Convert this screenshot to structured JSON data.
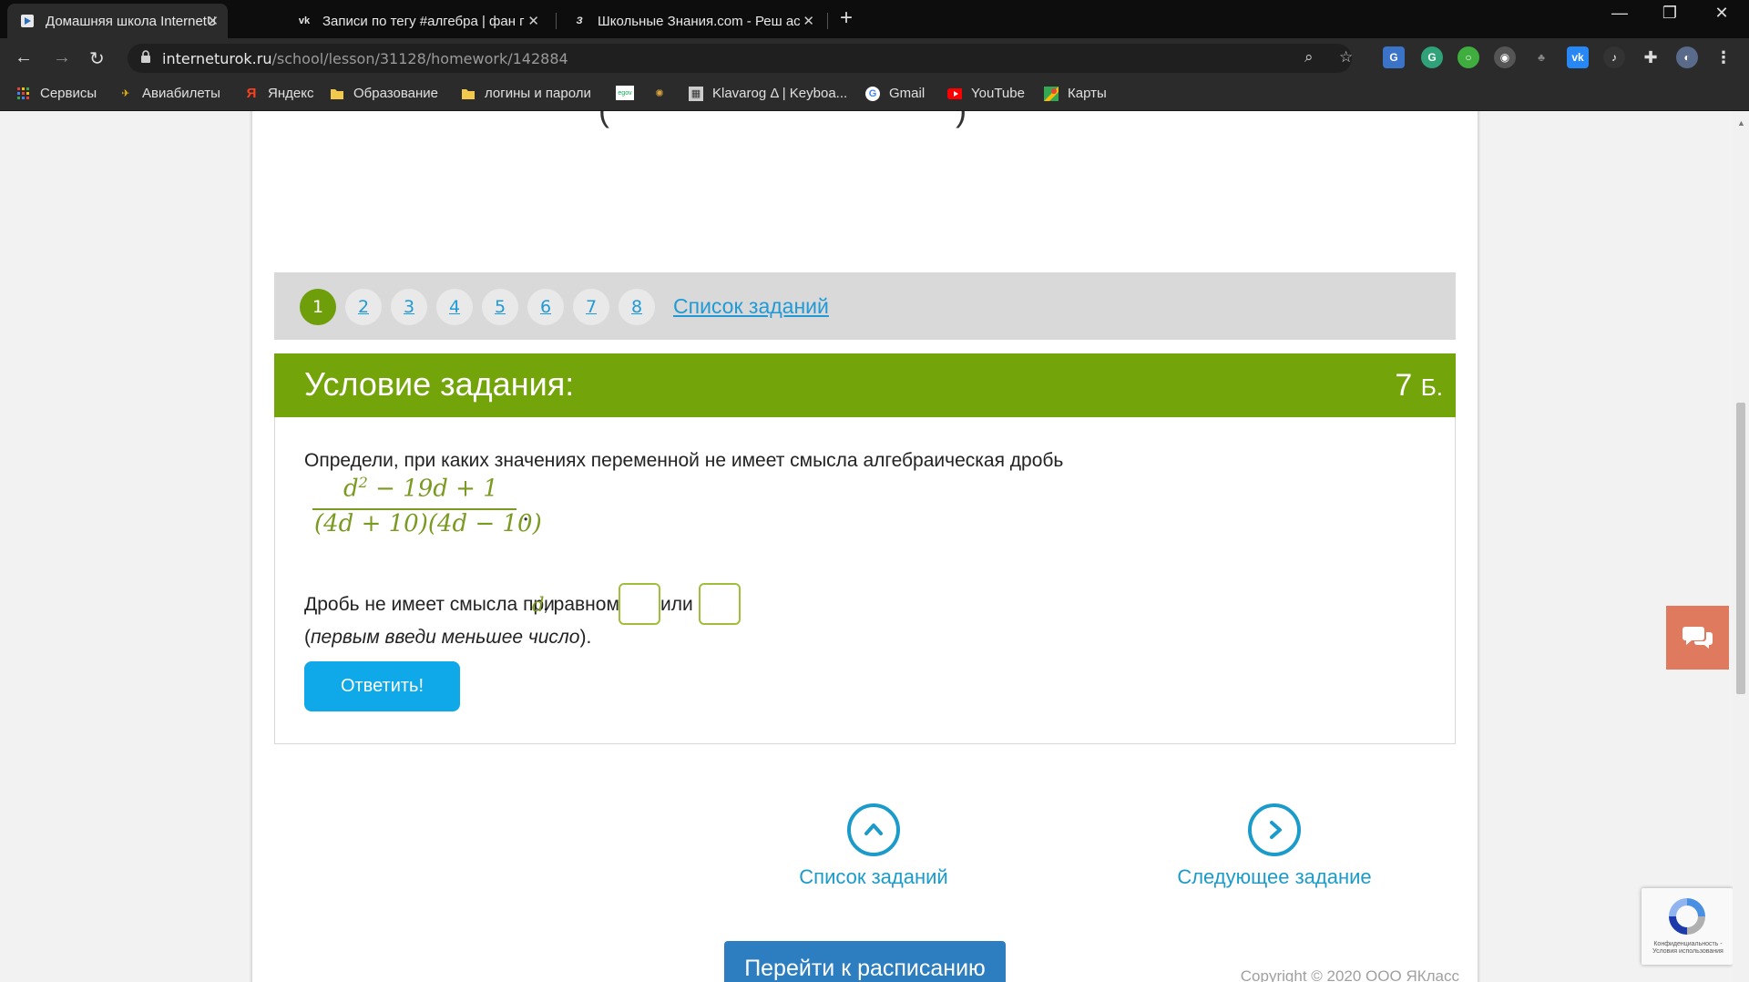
{
  "tabs": [
    {
      "title": "Домашняя школа InternetUrok.r",
      "active": true
    },
    {
      "title": "Записи по тегу #алгебра | фан г",
      "active": false
    },
    {
      "title": "Школьные Знания.com - Реш ас",
      "active": false
    }
  ],
  "toolbar": {
    "url_host": "interneturok.ru",
    "url_path": "/school/lesson/31128/homework/142884"
  },
  "bookmarks": [
    {
      "label": "Сервисы"
    },
    {
      "label": "Авиабилеты"
    },
    {
      "label": "Яндекс"
    },
    {
      "label": "Образование"
    },
    {
      "label": "логины и пароли"
    },
    {
      "label": ""
    },
    {
      "label": ""
    },
    {
      "label": "Klavarog Δ | Keyboa..."
    },
    {
      "label": "Gmail"
    },
    {
      "label": "YouTube"
    },
    {
      "label": "Карты"
    }
  ],
  "pager": {
    "pages": [
      "1",
      "2",
      "3",
      "4",
      "5",
      "6",
      "7",
      "8"
    ],
    "active_page": "1",
    "task_list_link": "Список заданий"
  },
  "condition": {
    "title": "Условие задания:",
    "points": "7",
    "points_unit": "Б.",
    "question": "Определи, при каких значениях переменной не имеет смысла алгебраическая дробь",
    "fraction_numerator_base": "d",
    "fraction_numerator_exp": "2",
    "fraction_numerator_rest": " − 19d + 1",
    "fraction_denominator": "(4d + 10)(4d − 10)",
    "fraction_end": ".",
    "answer_prefix": "Дробь не имеет смысла при",
    "answer_var": "d",
    "answer_mid": ", равном",
    "answer_or": "или",
    "answer_values": [
      "",
      ""
    ],
    "note_open": "(",
    "note_italic": "первым введи меньшее число",
    "note_close": ").",
    "submit_label": "Ответить!"
  },
  "bottom_nav": {
    "task_list_label": "Список заданий",
    "next_task_label": "Следующее задание"
  },
  "copyright": "Copyright © 2020 ООО ЯКласс",
  "recaptcha_text": "Конфиденциальность - Условия использования",
  "schedule_button": "Перейти к расписанию",
  "colors": {
    "accent_green": "#73a40a",
    "link_blue": "#1f9ad6",
    "button_blue": "#0fa8e8",
    "chat_orange": "#e07a5f"
  }
}
